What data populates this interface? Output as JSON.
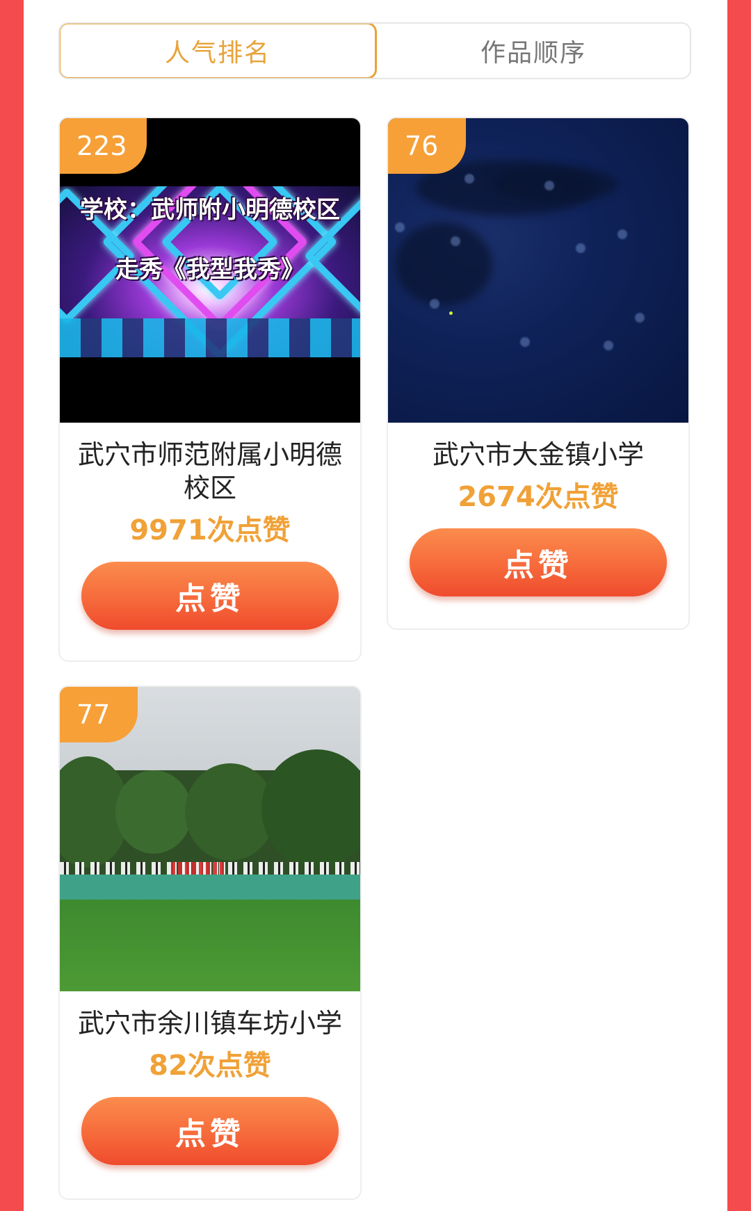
{
  "tabs": [
    {
      "label": "人气排名",
      "active": true
    },
    {
      "label": "作品顺序",
      "active": false
    }
  ],
  "cards": [
    {
      "rank": "223",
      "name": "武穴市师范附属小明德校区",
      "likes": "9971次点赞",
      "button": "点赞",
      "thumb_caption_line1": "学校：武师附小明德校区",
      "thumb_caption_line2": "走秀《我型我秀》"
    },
    {
      "rank": "76",
      "name": "武穴市大金镇小学",
      "likes": "2674次点赞",
      "button": "点赞"
    },
    {
      "rank": "77",
      "name": "武穴市余川镇车坊小学",
      "likes": "82次点赞",
      "button": "点赞"
    }
  ],
  "colors": {
    "background_red": "#f44c4e",
    "accent_orange": "#e7a33a",
    "badge_orange": "#f7a038",
    "button_gradient_top": "#fb8c4d",
    "button_gradient_bottom": "#ef4b2d"
  }
}
